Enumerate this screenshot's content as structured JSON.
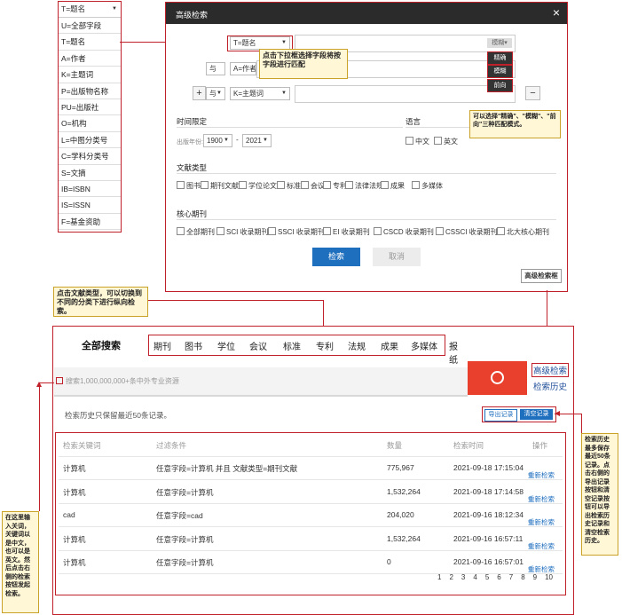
{
  "dropdown": {
    "header": "T=题名",
    "items": [
      "U=全部字段",
      "T=题名",
      "A=作者",
      "K=主题词",
      "P=出版物名称",
      "PU=出版社",
      "O=机构",
      "L=中图分类号",
      "C=学科分类号",
      "S=文摘",
      "IB=ISBN",
      "IS=ISSN",
      "F=基金资助"
    ]
  },
  "dialog": {
    "title": "高级检索",
    "close": "×",
    "row1_field": "T=题名",
    "row2_op": "与",
    "row2_field": "A=作者",
    "row3_op": "与",
    "row3_field": "K=主题词",
    "match_mode": "模糊",
    "match_options": [
      "精确",
      "模糊",
      "前向"
    ],
    "add": "+",
    "remove": "−",
    "time_label": "时间限定",
    "year_label": "出版年份:",
    "year_from": "1900",
    "year_to": "2021",
    "year_sep": "-",
    "lang_label": "语言",
    "lang_options": [
      "中文",
      "英文"
    ],
    "doctype_label": "文献类型",
    "doctypes": [
      "图书",
      "期刊文献",
      "学位论文",
      "标准",
      "会议",
      "专利",
      "法律法规",
      "成果",
      "多媒体"
    ],
    "core_label": "核心期刊",
    "cores": [
      "全部期刊",
      "SCI 收录期刊",
      "SSCI 收录期刊",
      "EI 收录期刊",
      "CSCD 收录期刊",
      "CSSCI 收录期刊",
      "北大核心期刊"
    ],
    "search_btn": "检索",
    "cancel_btn": "取消",
    "frame_label": "高级检索框"
  },
  "notes": {
    "dropdown_tip": "点击下拉框选择字段将按字段进行匹配",
    "match_tip": "可以选择\"精确\"、\"模糊\"、\"前向\"三种匹配模式。",
    "doctype_tip": "点击文献类型，可以切换到不同的分类下进行纵向检索。",
    "input_tip": "在这里输入关词，关键词以是中文，也可以是英文。然后点击右侧的检索按钮发起检索。",
    "history_tip": "检索历史最多保存最近50条记录。点击右侧的导出记录按钮和清空记录按钮可以导出检索历史记录和清空检索历史。"
  },
  "main": {
    "all_search": "全部搜索",
    "categories": [
      "期刊",
      "图书",
      "学位",
      "会议",
      "标准",
      "专利",
      "法规",
      "成果",
      "多媒体",
      "报纸"
    ],
    "placeholder": "搜索1,000,000,000+条中外专业资源",
    "adv_link": "高级检索",
    "history_link": "检索历史",
    "history_note": "检索历史只保留最近50条记录。",
    "export_btn": "导出记录",
    "clear_btn": "清空记录",
    "columns": [
      "检索关键词",
      "过滤条件",
      "数量",
      "检索时间",
      "操作"
    ],
    "rows": [
      {
        "kw": "计算机",
        "filter": "任意字段=计算机 并且 文献类型=期刊文献",
        "count": "775,967",
        "time": "2021-09-18 17:15:04",
        "op": "重新检索"
      },
      {
        "kw": "计算机",
        "filter": "任意字段=计算机",
        "count": "1,532,264",
        "time": "2021-09-18 17:14:58",
        "op": "重新检索"
      },
      {
        "kw": "cad",
        "filter": "任意字段=cad",
        "count": "204,020",
        "time": "2021-09-16 18:12:34",
        "op": "重新检索"
      },
      {
        "kw": "计算机",
        "filter": "任意字段=计算机",
        "count": "1,532,264",
        "time": "2021-09-16 16:57:11",
        "op": "重新检索"
      },
      {
        "kw": "计算机",
        "filter": "任意字段=计算机",
        "count": "0",
        "time": "2021-09-16 16:57:01",
        "op": "重新检索"
      }
    ],
    "pages": [
      "1",
      "2",
      "3",
      "4",
      "5",
      "6",
      "7",
      "8",
      "9",
      "10"
    ]
  },
  "colors": {
    "accent_red": "#c0202a",
    "dialog_header": "#2b2b2b",
    "search_btn": "#1f6fbf",
    "red_search": "#e8402d"
  }
}
